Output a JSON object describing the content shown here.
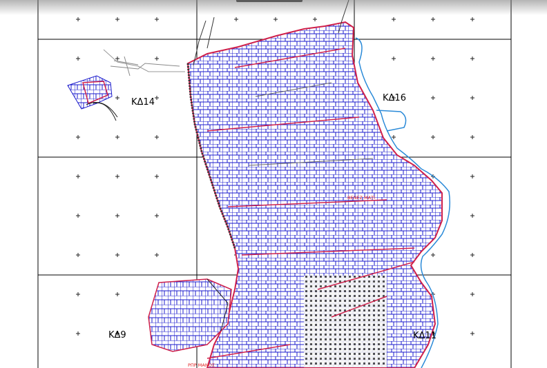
{
  "map": {
    "sheets": [
      {
        "id": "kd14",
        "label": "ΚΔ14"
      },
      {
        "id": "kd16",
        "label": "ΚΔ16"
      },
      {
        "id": "kd9",
        "label": "ΚΔ9"
      },
      {
        "id": "kd11",
        "label": "ΚΔ11"
      }
    ],
    "annotations": {
      "district_label": "ΒΕΝΕΖ ΜΑΤΙ",
      "bottom_label": "ΡΠΡ ΜΑΝΟΣ"
    },
    "colors": {
      "parcel_lines": "#1a1acc",
      "boundary": "#d0204a",
      "coastline": "#2a8ad8",
      "grid": "#000000",
      "buildings": "#303030",
      "annotation_text": "#e02020"
    }
  }
}
